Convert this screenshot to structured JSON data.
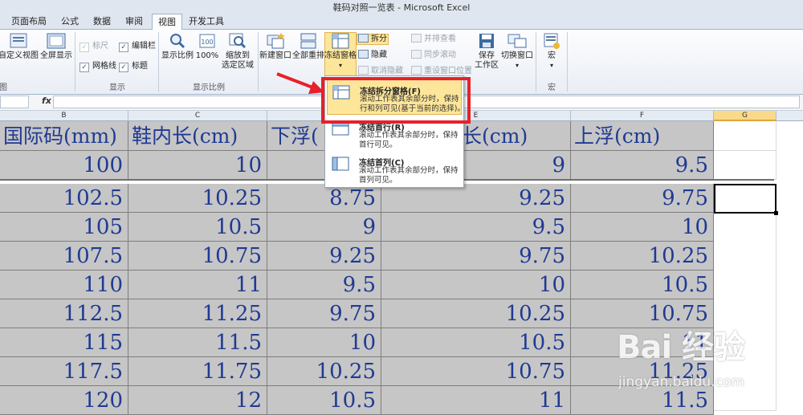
{
  "window": {
    "title": "鞋码对照一览表 - Microsoft Excel"
  },
  "tabs": [
    {
      "label": "页面布局",
      "active": false
    },
    {
      "label": "公式",
      "active": false
    },
    {
      "label": "数据",
      "active": false
    },
    {
      "label": "审阅",
      "active": false
    },
    {
      "label": "视图",
      "active": true
    },
    {
      "label": "开发工具",
      "active": false
    }
  ],
  "ribbon": {
    "workbook_views": {
      "custom_view": "自定义视图",
      "full_screen": "全屏显示",
      "group_label": "图"
    },
    "show": {
      "ruler": "标尺",
      "formula_bar": "编辑栏",
      "gridlines": "网格线",
      "headings": "标题",
      "group_label": "显示"
    },
    "zoom": {
      "zoom": "显示比例",
      "hundred": "100%",
      "to_selection_line1": "缩放到",
      "to_selection_line2": "选定区域",
      "group_label": "显示比例"
    },
    "window": {
      "new_window": "新建窗口",
      "arrange_all": "全部重排",
      "freeze_panes": "冻结窗格",
      "split": "拆分",
      "hide": "隐藏",
      "unhide": "取消隐藏",
      "side_by_side": "并排查看",
      "sync_scroll": "同步滚动",
      "reset_position": "重设窗口位置",
      "save_workspace_line1": "保存",
      "save_workspace_line2": "工作区",
      "switch_windows": "切换窗口"
    },
    "macros": {
      "macros": "宏",
      "group_label": "宏"
    }
  },
  "formula_bar": {
    "fx": "fx",
    "value": ""
  },
  "columns": [
    "B",
    "C",
    "D",
    "E",
    "F",
    "G"
  ],
  "sheet": {
    "headers": [
      "国际码(mm)",
      "鞋内长(cm)",
      "下浮(",
      "长(cm)",
      "上浮(cm)"
    ],
    "rows": [
      [
        "100",
        "10",
        "",
        "9",
        "9.5"
      ],
      [
        "102.5",
        "10.25",
        "8.75",
        "9.25",
        "9.75"
      ],
      [
        "105",
        "10.5",
        "9",
        "9.5",
        "10"
      ],
      [
        "107.5",
        "10.75",
        "9.25",
        "9.75",
        "10.25"
      ],
      [
        "110",
        "11",
        "9.5",
        "10",
        "10.5"
      ],
      [
        "112.5",
        "11.25",
        "9.75",
        "10.25",
        "10.75"
      ],
      [
        "115",
        "11.5",
        "10",
        "10.5",
        "11"
      ],
      [
        "117.5",
        "11.75",
        "10.25",
        "10.75",
        "11.25"
      ],
      [
        "120",
        "12",
        "10.5",
        "11",
        "11.5"
      ]
    ]
  },
  "freeze_menu": {
    "items": [
      {
        "title": "冻结拆分窗格(F)",
        "desc1": "滚动工作表其余部分时，保持",
        "desc2": "行和列可见(基于当前的选择)。"
      },
      {
        "title": "冻结首行(R)",
        "desc1": "滚动工作表其余部分时，保持",
        "desc2": "首行可见。"
      },
      {
        "title": "冻结首列(C)",
        "desc1": "滚动工作表其余部分时，保持",
        "desc2": "首列可见。"
      }
    ]
  },
  "watermark": {
    "logo": "Bai 经验",
    "url": "jingyan.baidu.com"
  },
  "colors": {
    "highlight": "#fde59a",
    "annotation_red": "#e8202a",
    "cell_text": "#1f3a93",
    "cell_gray": "#c6c6c6"
  }
}
